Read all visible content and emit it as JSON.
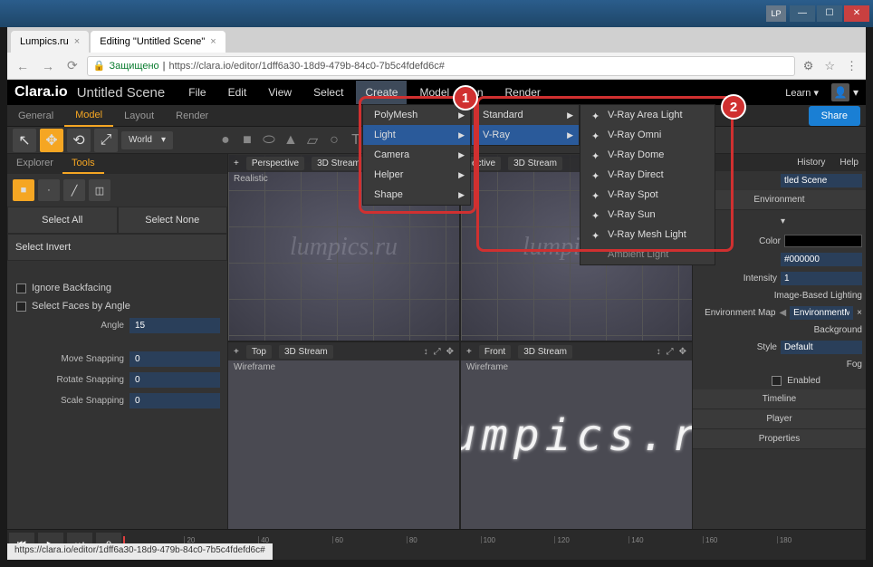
{
  "window": {
    "lp": "LP"
  },
  "browser": {
    "tabs": [
      {
        "title": "Lumpics.ru"
      },
      {
        "title": "Editing \"Untitled Scene\""
      }
    ],
    "secure_label": "Защищено",
    "url": "https://clara.io/editor/1dff6a30-18d9-479b-84c0-7b5c4fdefd6c#"
  },
  "app": {
    "logo": "Clara.io",
    "scene_title": "Untitled Scene",
    "menus": [
      "File",
      "Edit",
      "View",
      "Select",
      "Create",
      "Model",
      "on",
      "Render"
    ],
    "learn": "Learn",
    "share": "Share",
    "sub_tabs": [
      "General",
      "Model",
      "Layout",
      "Render"
    ],
    "coord_space": "World"
  },
  "left": {
    "tabs": [
      "Explorer",
      "Tools"
    ],
    "select_all": "Select All",
    "select_none": "Select None",
    "select_invert": "Select Invert",
    "ignore_backfacing": "Ignore Backfacing",
    "select_faces": "Select Faces by Angle",
    "angle_label": "Angle",
    "angle_value": "15",
    "move_label": "Move Snapping",
    "move_value": "0",
    "rotate_label": "Rotate Snapping",
    "rotate_value": "0",
    "scale_label": "Scale Snapping",
    "scale_value": "0"
  },
  "viewports": {
    "persp": {
      "tab": "Perspective",
      "stream": "3D Stream",
      "mode": "Realistic"
    },
    "other": {
      "tab": "ective",
      "stream": "3D Stream"
    },
    "top": {
      "tab": "Top",
      "stream": "3D Stream",
      "mode": "Wireframe"
    },
    "front": {
      "tab": "Front",
      "stream": "3D Stream",
      "mode": "Wireframe"
    },
    "watermark": "lumpics.ru"
  },
  "right": {
    "tabs": [
      "",
      "History",
      "Help"
    ],
    "name_label": "",
    "name_value": "tled Scene",
    "env_section": "Environment",
    "color_label": "Color",
    "color_value": "#000000",
    "intensity_label": "Intensity",
    "intensity_value": "1",
    "ibl_label": "Image-Based Lighting",
    "envmap_label": "Environment Map",
    "envmap_value": "EnvironmentMap",
    "bg_label": "Background",
    "style_label": "Style",
    "style_value": "Default",
    "fog_label": "Fog",
    "enabled_label": "Enabled",
    "timeline_section": "Timeline",
    "player_section": "Player",
    "properties_section": "Properties"
  },
  "dropdown1": {
    "items": [
      "PolyMesh",
      "Light",
      "Camera",
      "Helper",
      "Shape"
    ]
  },
  "dropdown2": {
    "items": [
      "Standard",
      "V-Ray"
    ]
  },
  "dropdown3": {
    "items": [
      "V-Ray Area Light",
      "V-Ray Omni",
      "V-Ray Dome",
      "V-Ray Direct",
      "V-Ray Spot",
      "V-Ray Sun",
      "V-Ray Mesh Light",
      "Ambient Light"
    ]
  },
  "callouts": {
    "one": "1",
    "two": "2"
  },
  "timeline": {
    "ticks": [
      "0",
      "20",
      "40",
      "60",
      "80",
      "100",
      "120",
      "140",
      "160",
      "180"
    ]
  },
  "status": "https://clara.io/editor/1dff6a30-18d9-479b-84c0-7b5c4fdefd6c#"
}
